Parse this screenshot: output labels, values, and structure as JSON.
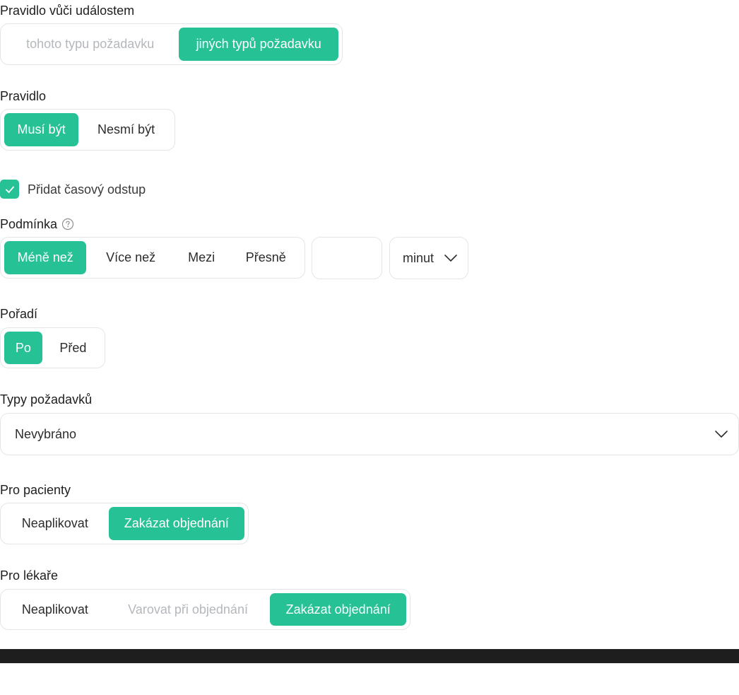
{
  "event_rule": {
    "label": "Pravidlo vůči událostem",
    "options": [
      "tohoto typu požadavku",
      "jiných typů požadavku"
    ],
    "selected": "jiných typů požadavku"
  },
  "rule": {
    "label": "Pravidlo",
    "options": [
      "Musí být",
      "Nesmí být"
    ],
    "selected": "Musí být"
  },
  "time_offset": {
    "checked": true,
    "label": "Přidat časový odstup"
  },
  "condition": {
    "label": "Podmínka",
    "help_icon": "question-circle-icon",
    "options": [
      "Méně než",
      "Více než",
      "Mezi",
      "Přesně"
    ],
    "selected": "Méně než",
    "value": "",
    "unit": "minut",
    "unit_icon": "chevron-down-icon"
  },
  "order": {
    "label": "Pořadí",
    "options": [
      "Po",
      "Před"
    ],
    "selected": "Po"
  },
  "request_types": {
    "label": "Typy požadavků",
    "value": "Nevybráno",
    "icon": "chevron-down-icon"
  },
  "for_patients": {
    "label": "Pro pacienty",
    "options": [
      "Neaplikovat",
      "Zakázat objednání"
    ],
    "selected": "Zakázat objednání"
  },
  "for_doctors": {
    "label": "Pro lékaře",
    "options": [
      "Neaplikovat",
      "Varovat při objednání",
      "Zakázat objednání"
    ],
    "selected": "Zakázat objednání"
  },
  "colors": {
    "accent": "#27c196",
    "border": "#e3e6e8",
    "footer": "#1e1e1e"
  }
}
